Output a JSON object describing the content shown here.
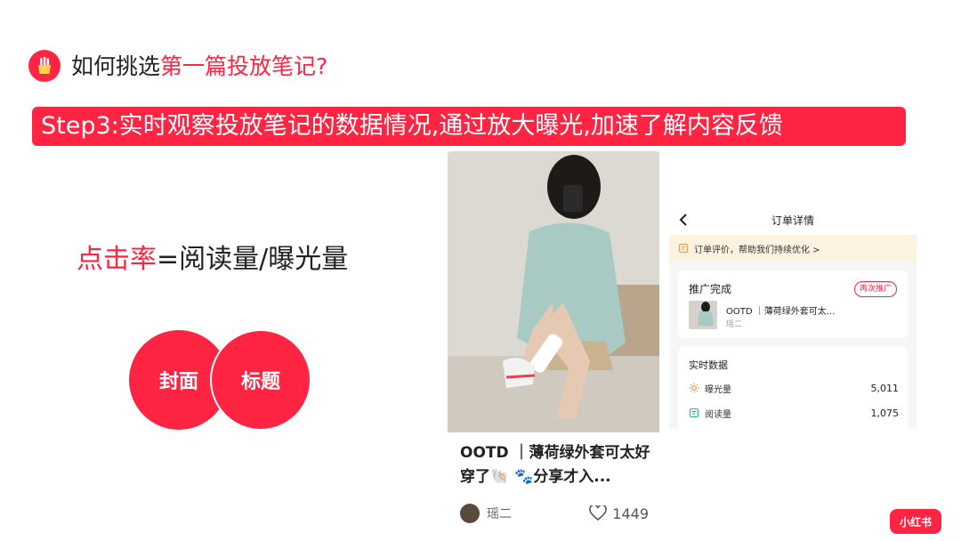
{
  "header": {
    "title_prefix": "如何挑选",
    "title_highlight": "第一篇投放笔记?",
    "icon": "fries-icon"
  },
  "step_banner": "Step3:实时观察投放笔记的数据情况,通过放大曝光,加速了解内容反馈",
  "formula": {
    "highlight": "点击率",
    "rest": "=阅读量/曝光量"
  },
  "circles": {
    "left": "封面",
    "right": "标题"
  },
  "note_card": {
    "title": "OOTD ｜薄荷绿外套可太好穿了🐚 🐾分享才入...",
    "author": "瑶二",
    "likes": "1449",
    "like_icon": "heart-outline-icon"
  },
  "order_panel": {
    "title": "订单详情",
    "feedback": "订单评价，帮助我们持续优化 >",
    "status": "推广完成",
    "repromote_button": "再次推广",
    "note_title": "OOTD ｜薄荷绿外套可太...",
    "note_author": "瑶二",
    "stats_title": "实时数据",
    "stats": [
      {
        "label": "曝光量",
        "value": "5,011",
        "icon": "sun-icon"
      },
      {
        "label": "阅读量",
        "value": "1,075",
        "icon": "read-icon"
      }
    ]
  },
  "brand": "小红书",
  "colors": {
    "accent": "#ff2442",
    "feedback_bg": "#fdf2df"
  }
}
